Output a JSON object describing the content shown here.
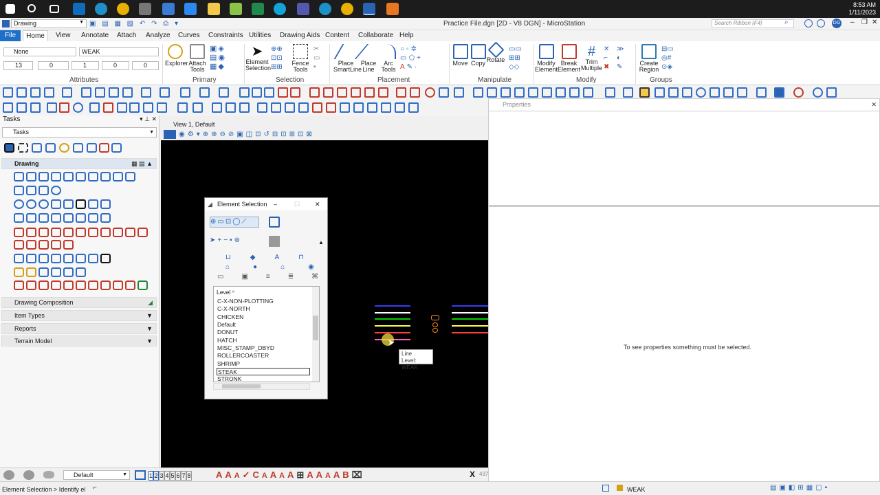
{
  "taskbar": {
    "time": "8:53 AM",
    "date": "1/11/2023"
  },
  "window": {
    "title": "Practice File.dgn [2D - V8 DGN] - MicroStation",
    "workflow": "Drawing",
    "search_placeholder": "Search Ribbon (F4)",
    "user_initials": "DG"
  },
  "ribbon_tabs": [
    "File",
    "Home",
    "View",
    "Annotate",
    "Attach",
    "Analyze",
    "Curves",
    "Constraints",
    "Utilities",
    "Drawing Aids",
    "Content",
    "Collaborate",
    "Help"
  ],
  "attributes": {
    "level_left": "None",
    "level_right": "WEAK",
    "color": "13",
    "style": "0",
    "weight": "1",
    "transparency": "0",
    "priority": "0"
  },
  "groups": {
    "attributes": "Attributes",
    "primary": "Primary",
    "selection": "Selection",
    "placement": "Placement",
    "manipulate": "Manipulate",
    "modify": "Modify",
    "groups": "Groups"
  },
  "buttons": {
    "explorer": "Explorer",
    "attach_tools_1": "Attach",
    "attach_tools_2": "Tools",
    "element_selection_1": "Element",
    "element_selection_2": "Selection",
    "fence_tools_1": "Fence",
    "fence_tools_2": "Tools",
    "place_smartline_1": "Place",
    "place_smartline_2": "SmartLine",
    "place_line_1": "Place",
    "place_line_2": "Line",
    "arc_tools_1": "Arc",
    "arc_tools_2": "Tools",
    "move": "Move",
    "copy": "Copy",
    "rotate": "Rotate",
    "modify_element_1": "Modify",
    "modify_element_2": "Element",
    "break_element_1": "Break",
    "break_element_2": "Element",
    "trim_multiple_1": "Trim",
    "trim_multiple_2": "Multiple",
    "create_region_1": "Create",
    "create_region_2": "Region"
  },
  "tasks": {
    "title": "Tasks",
    "dropdown": "Tasks",
    "drawing": "Drawing",
    "drawing_composition": "Drawing Composition",
    "item_types": "Item Types",
    "reports": "Reports",
    "terrain_model": "Terrain Model"
  },
  "view": {
    "title": "View 1, Default"
  },
  "element_selection": {
    "title": "Element Selection",
    "level_header": "Level",
    "levels": [
      "C-X-NON-PLOTTING",
      "C-X-NORTH",
      "CHICKEN",
      "Default",
      "DONUT",
      "HATCH",
      "MISC_STAMP_DBYD",
      "ROLLERCOASTER",
      "SHRIMP",
      "STEAK",
      "STRONK"
    ],
    "selected_level": "STEAK"
  },
  "tooltip": {
    "line1": "Line",
    "line2": "Level: WEAK"
  },
  "properties": {
    "title": "Properties",
    "message": "To see properties something must be selected."
  },
  "bottom": {
    "model": "Default",
    "view_numbers": [
      "1",
      "2",
      "3",
      "4",
      "5",
      "6",
      "7",
      "8"
    ],
    "prompt": "Element Selection > Identify el",
    "status_level": "WEAK",
    "coord_partial": "437"
  },
  "drawing_lines": [
    {
      "color": "#3a3aff"
    },
    {
      "color": "#ffffff"
    },
    {
      "color": "#00d000"
    },
    {
      "color": "#ffff40"
    },
    {
      "color": "#ff4040"
    },
    {
      "color": "#ff60c0"
    }
  ]
}
